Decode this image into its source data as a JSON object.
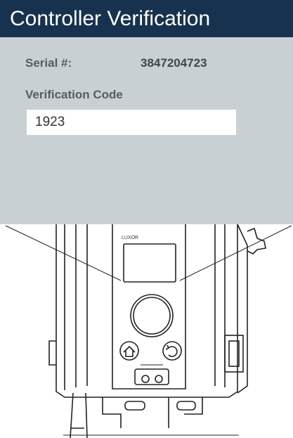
{
  "header": {
    "title": "Controller Verification"
  },
  "form": {
    "serial_label": "Serial #:",
    "serial_value": "3847204723",
    "code_label": "Verification Code",
    "code_value": "1923"
  },
  "device": {
    "brand": "LUXOR",
    "icons": [
      "home-icon",
      "back-icon",
      "power-port-icon"
    ]
  },
  "colors": {
    "header_bg": "#17324f",
    "panel_bg": "#c8d0d4",
    "label_text": "#555d61"
  }
}
